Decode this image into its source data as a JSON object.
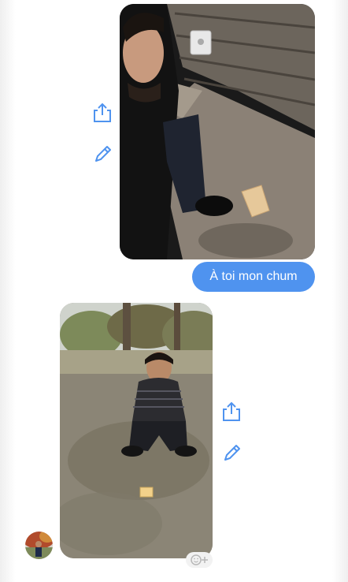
{
  "conversation": {
    "messages": [
      {
        "kind": "photo",
        "direction": "sent",
        "subject": "selfie-with-bread-slice"
      },
      {
        "kind": "text",
        "direction": "sent",
        "text": "À toi mon chum"
      },
      {
        "kind": "photo",
        "direction": "received",
        "subject": "crouching-man-with-bread-slice"
      }
    ]
  },
  "icons": {
    "share": "share-icon",
    "edit": "pencil-icon",
    "react": "add-reaction-icon"
  },
  "colors": {
    "sent_bubble": "#4f93ef",
    "sent_text": "#ffffff",
    "action_icon": "#4f93ef",
    "background": "#ffffff"
  }
}
